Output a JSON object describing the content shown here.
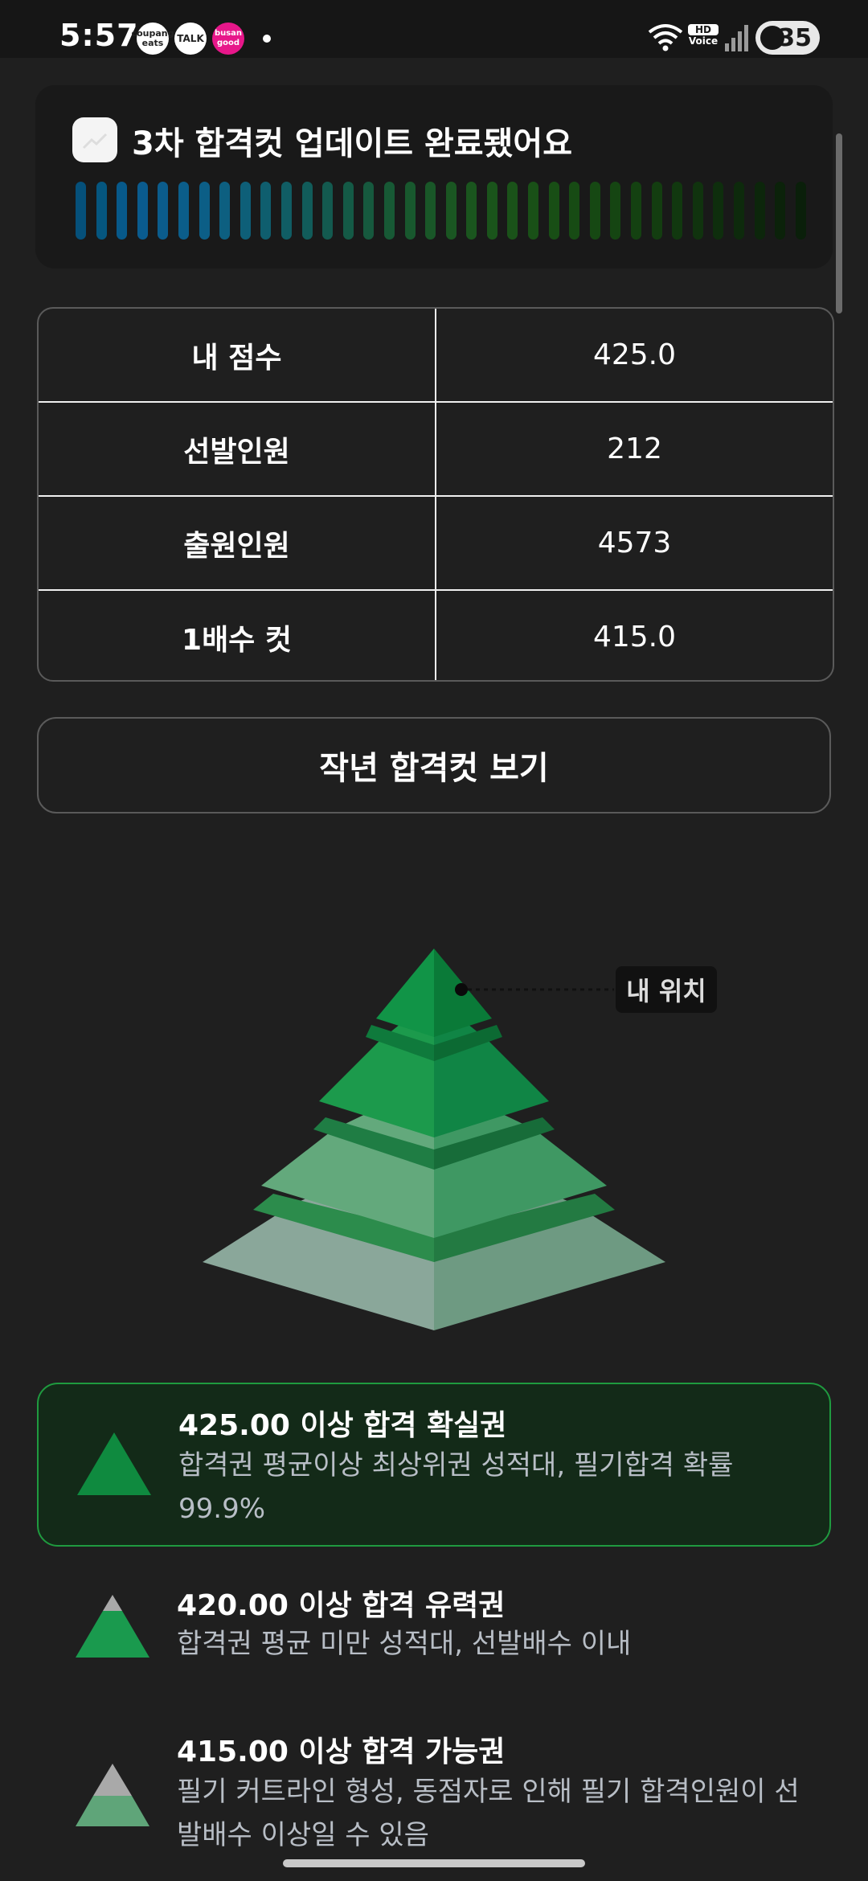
{
  "status_bar": {
    "time": "5:57",
    "apps": [
      "coupang eats",
      "TALK",
      "busan good"
    ],
    "hd_voice": "Voice",
    "battery": "35"
  },
  "notification": {
    "title": "3차 합격컷 업데이트 완료됐어요",
    "progress_colors": [
      "#05507a",
      "#05567f",
      "#07598a",
      "#0a5b8e",
      "#0b5c8c",
      "#0b5d8a",
      "#0c5e86",
      "#0d5f80",
      "#0e5f78",
      "#0f5e6e",
      "#105d64",
      "#115c5a",
      "#135a4f",
      "#145a46",
      "#16593e",
      "#175935",
      "#18582e",
      "#195728",
      "#1a5622",
      "#1a551e",
      "#1a541b",
      "#1a5219",
      "#195017",
      "#184e15",
      "#174b14",
      "#164813",
      "#154512",
      "#144111",
      "#133d10",
      "#11380f",
      "#10330e",
      "#0e2e0d",
      "#0d2a0c",
      "#0c260b",
      "#0b220a",
      "#0a1f0a"
    ]
  },
  "info_table": [
    {
      "label": "내 점수",
      "value": "425.0"
    },
    {
      "label": "선발인원",
      "value": "212"
    },
    {
      "label": "출원인원",
      "value": "4573"
    },
    {
      "label": "1배수 컷",
      "value": "415.0"
    }
  ],
  "prev_cut_button": "작년 합격컷 보기",
  "my_position_label": "내 위치",
  "tiers": [
    {
      "title": "425.00 이상 합격 확실권",
      "desc": "합격권 평균이상 최상위권 성적대, 필기합격 확률 99.9%",
      "active": true
    },
    {
      "title": "420.00 이상 합격 유력권",
      "desc": "합격권 평균 미만 성적대, 선발배수 이내",
      "active": false
    },
    {
      "title": "415.00 이상 합격 가능권",
      "desc": "필기 커트라인 형성, 동점자로 인해 필기 합격인원이 선발배수 이상일 수 있음",
      "active": false
    }
  ],
  "colors": {
    "accent_green": "#1f9a3f",
    "tier_top": "#0f8a3f",
    "tier_mid": "#4aa868",
    "tier_low": "#8fa79a"
  }
}
